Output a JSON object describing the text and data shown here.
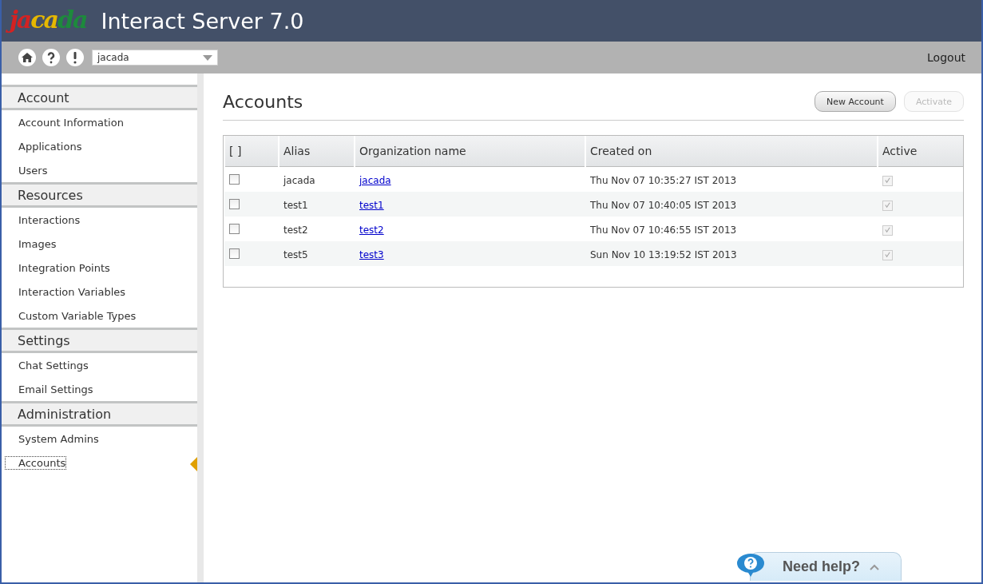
{
  "header": {
    "logo": [
      {
        "text": "ja",
        "color": "#d42222"
      },
      {
        "text": "ca",
        "color": "#e6b800"
      },
      {
        "text": "da",
        "color": "#1d8a3c"
      }
    ],
    "title": "Interact Server 7.0"
  },
  "toolbar": {
    "account_select": {
      "value": "jacada"
    },
    "logout": "Logout"
  },
  "sidebar": {
    "groups": [
      {
        "title": "Account",
        "items": [
          {
            "label": "Account Information",
            "selected": false
          },
          {
            "label": "Applications",
            "selected": false
          },
          {
            "label": "Users",
            "selected": false
          }
        ]
      },
      {
        "title": "Resources",
        "items": [
          {
            "label": "Interactions",
            "selected": false
          },
          {
            "label": "Images",
            "selected": false
          },
          {
            "label": "Integration Points",
            "selected": false
          },
          {
            "label": "Interaction Variables",
            "selected": false
          },
          {
            "label": "Custom Variable Types",
            "selected": false
          }
        ]
      },
      {
        "title": "Settings",
        "items": [
          {
            "label": "Chat Settings",
            "selected": false
          },
          {
            "label": "Email Settings",
            "selected": false
          }
        ]
      },
      {
        "title": "Administration",
        "items": [
          {
            "label": "System Admins",
            "selected": false
          },
          {
            "label": "Accounts",
            "selected": true
          }
        ]
      }
    ]
  },
  "main": {
    "title": "Accounts",
    "buttons": [
      {
        "label": "New Account",
        "disabled": false
      },
      {
        "label": "Activate",
        "disabled": true
      }
    ],
    "table": {
      "columns": [
        "[ ]",
        "Alias",
        "Organization name",
        "Created on",
        "Active"
      ],
      "rows": [
        {
          "checked": false,
          "alias": "jacada",
          "organization": "jacada",
          "created_on": "Thu Nov 07 10:35:27 IST 2013",
          "active": true
        },
        {
          "checked": false,
          "alias": "test1",
          "organization": "test1",
          "created_on": "Thu Nov 07 10:40:05 IST 2013",
          "active": true
        },
        {
          "checked": false,
          "alias": "test2",
          "organization": "test2",
          "created_on": "Thu Nov 07 10:46:55 IST 2013",
          "active": true
        },
        {
          "checked": false,
          "alias": "test5",
          "organization": "test3",
          "created_on": "Sun Nov 10 13:19:52 IST 2013",
          "active": true
        }
      ]
    }
  },
  "help_widget": {
    "label": "Need help?"
  }
}
